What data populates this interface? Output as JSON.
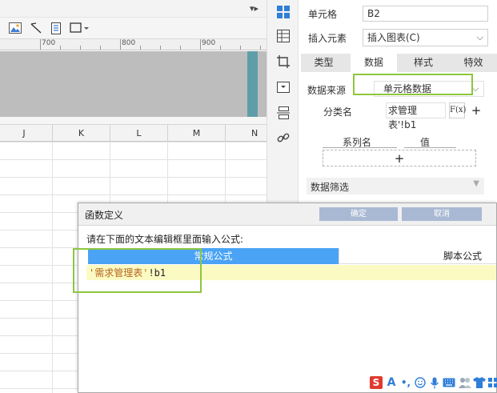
{
  "sheet": {
    "ruler_ticks": [
      "700",
      "800",
      "900"
    ],
    "columns": [
      "J",
      "K",
      "L",
      "M",
      "N"
    ]
  },
  "panel": {
    "cell_label": "单元格",
    "cell_value": "B2",
    "insert_label": "插入元素",
    "insert_value": "插入图表(C)",
    "tabs": [
      {
        "label": "类型",
        "active": false
      },
      {
        "label": "数据",
        "active": true
      },
      {
        "label": "样式",
        "active": false
      },
      {
        "label": "特效",
        "active": false
      }
    ],
    "datasource_label": "数据来源",
    "datasource_value": "单元格数据",
    "category_label": "分类名",
    "category_value": "求管理表'!b1",
    "formula_button": "F(x)",
    "series_name_header": "系列名",
    "value_header": "值",
    "filter_label": "数据筛选"
  },
  "dialog": {
    "title": "函数定义",
    "title_btn_1": "确定",
    "title_btn_2": "取消",
    "instruction": "请在下面的文本编辑框里面输入公式:",
    "tab_normal": "常规公式",
    "tab_script": "脚本公式",
    "formula_string": "'需求管理表'",
    "formula_ref": "!b1"
  },
  "ime": {
    "logo": "S",
    "icons": [
      "text-icon",
      "punct-icon",
      "emoji-icon",
      "mic-icon",
      "keyboard-icon",
      "users-icon",
      "shirt-icon",
      "grid-icon"
    ]
  },
  "colors": {
    "highlight_green": "#8dc63f",
    "tab_blue": "#4aa3f5",
    "formula_bg": "#fbfac3"
  }
}
